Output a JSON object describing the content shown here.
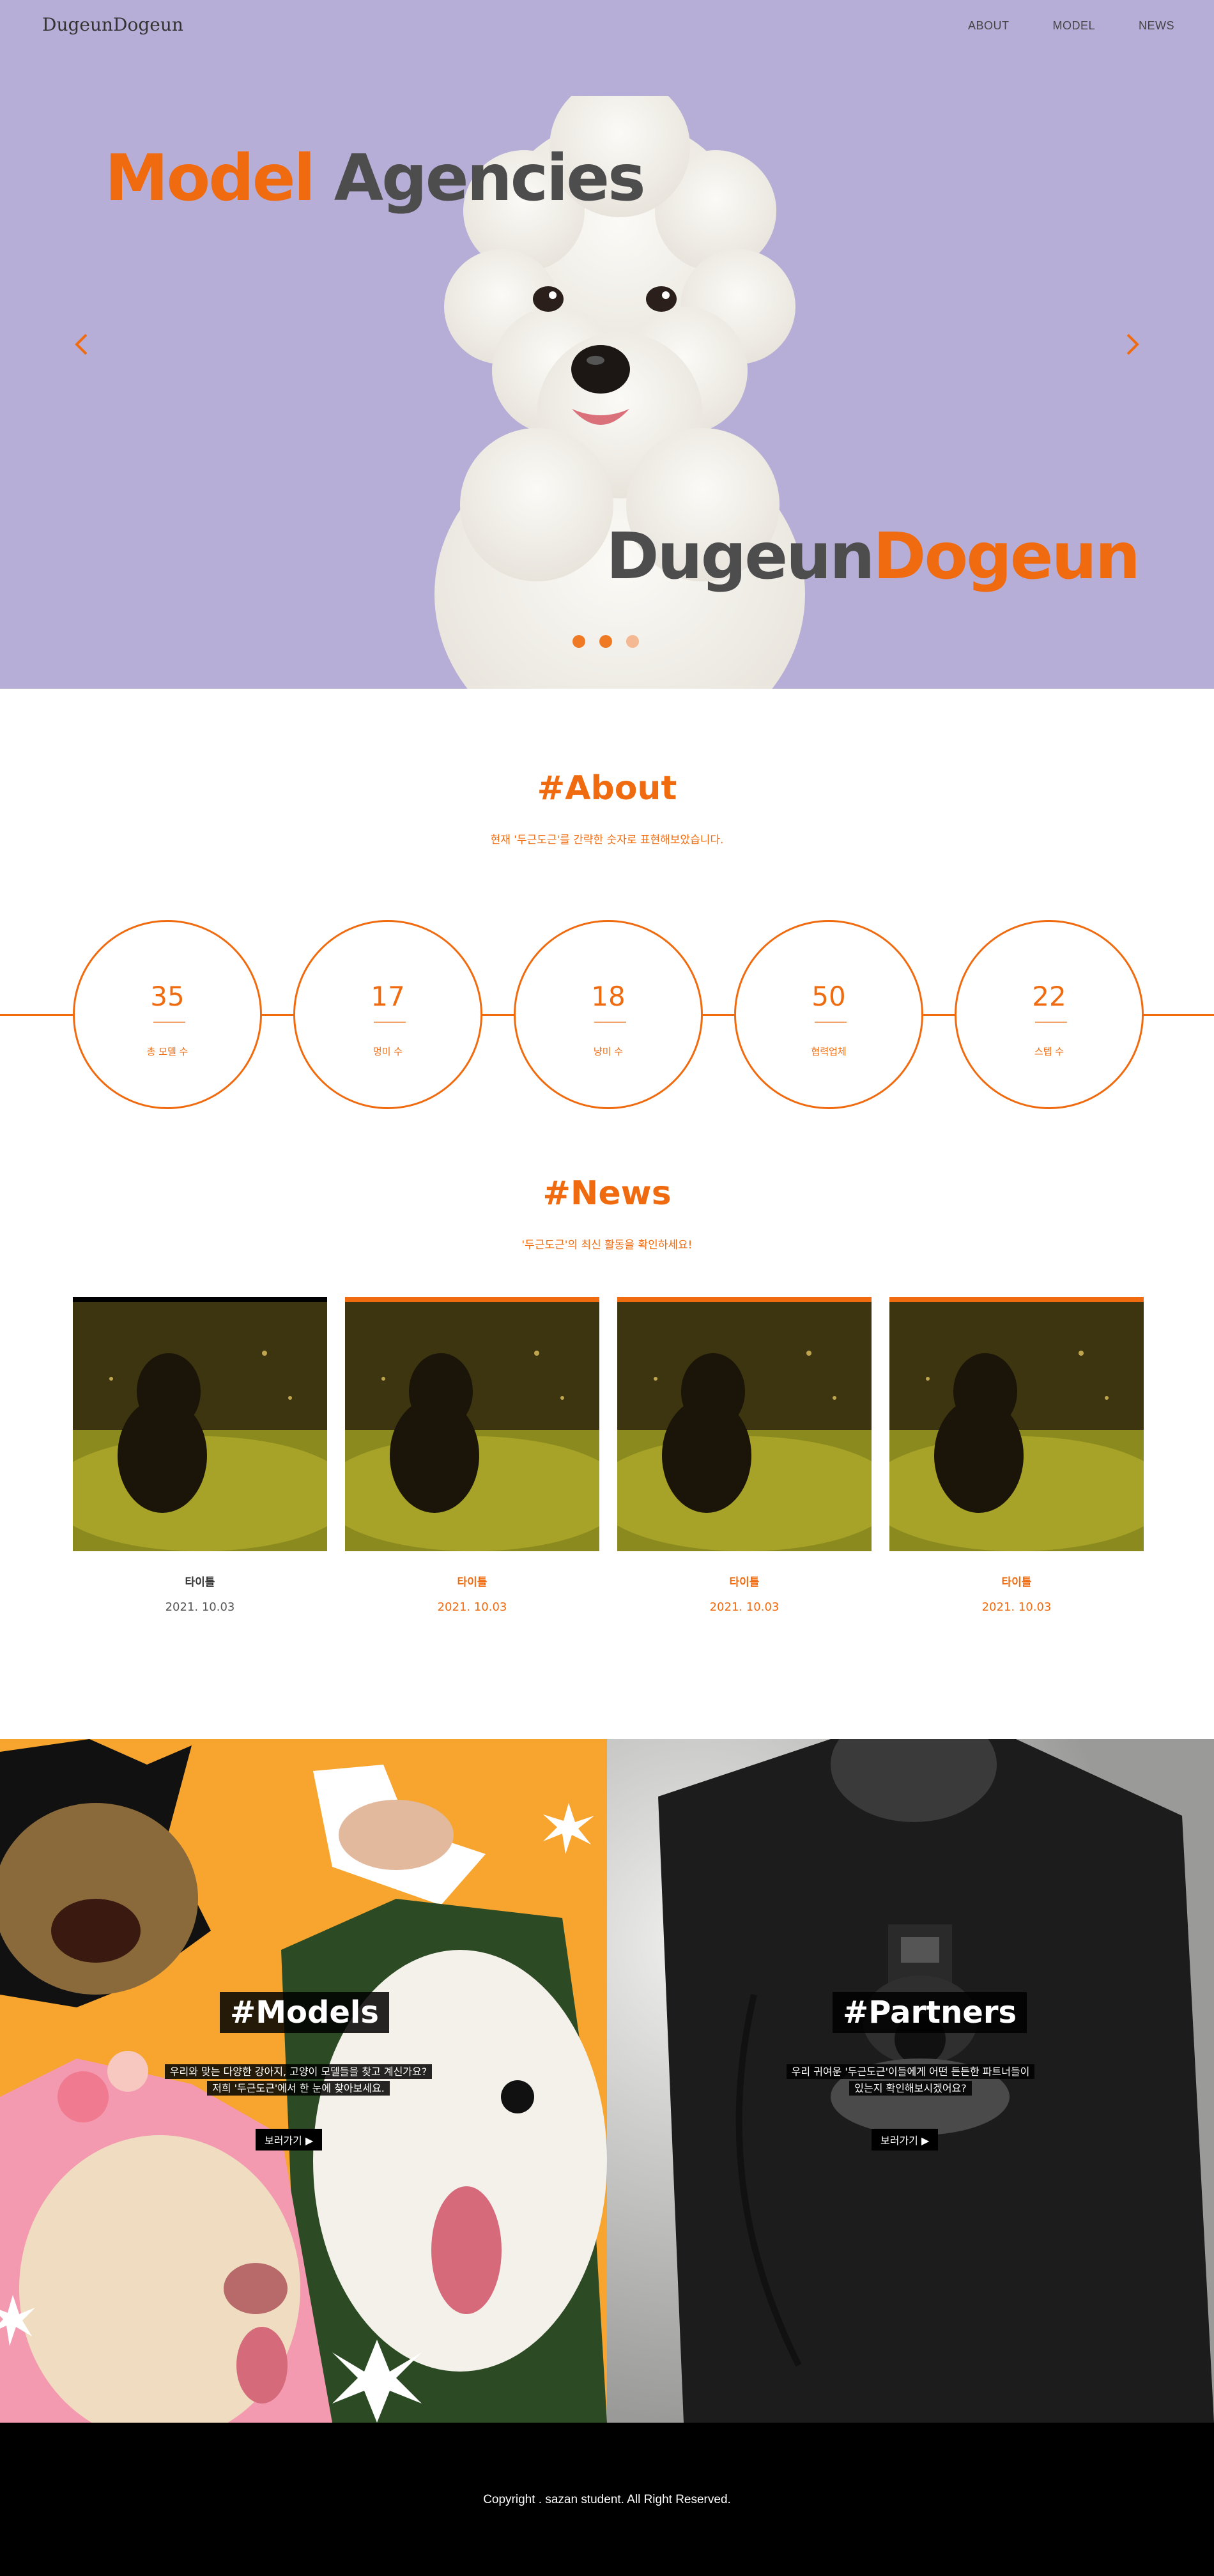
{
  "header": {
    "logo": "DugeunDogeun",
    "nav": [
      "ABOUT",
      "MODEL",
      "NEWS"
    ]
  },
  "hero": {
    "title_highlight": "Model",
    "title_rest": "Agencies",
    "brand_plain": "Dugeun",
    "brand_highlight": "Dogeun",
    "slide_dots": 3,
    "active_slide": 1
  },
  "about": {
    "title": "#About",
    "subtitle": "현재 '두근도근'를 간략한 숫자로 표현해보았습니다.",
    "stats": [
      {
        "value": "35",
        "label": "총 모델 수"
      },
      {
        "value": "17",
        "label": "멍미 수"
      },
      {
        "value": "18",
        "label": "냥미 수"
      },
      {
        "value": "50",
        "label": "협력업체"
      },
      {
        "value": "22",
        "label": "스텝 수"
      }
    ]
  },
  "news": {
    "title": "#News",
    "subtitle": "'두근도근'의 최신 활동을 확인하세요!",
    "items": [
      {
        "title": "타이틀",
        "date": "2021. 10.03"
      },
      {
        "title": "타이틀",
        "date": "2021. 10.03"
      },
      {
        "title": "타이틀",
        "date": "2021. 10.03"
      },
      {
        "title": "타이틀",
        "date": "2021. 10.03"
      }
    ]
  },
  "models": {
    "heading": "#Models",
    "line1": "우리와 맞는 다양한 강아지, 고양이 모델들을 찾고 계신가요?",
    "line2": "저희 '두근도근'에서 한 눈에 찾아보세요.",
    "button": "보러가기 ▶"
  },
  "partners": {
    "heading": "#Partners",
    "line1": "우리 귀여운 '두근도근'이들에게 어떤 든든한 파트너들이",
    "line2": "있는지 확인해보시겠어요?",
    "button": "보러가기 ▶"
  },
  "footer": {
    "copyright": "Copyright . sazan student. All Right Reserved."
  },
  "colors": {
    "accent": "#f06b0f",
    "hero_bg": "#b7aed7",
    "models_bg": "#f7a52e",
    "footer_bg": "#000000"
  }
}
